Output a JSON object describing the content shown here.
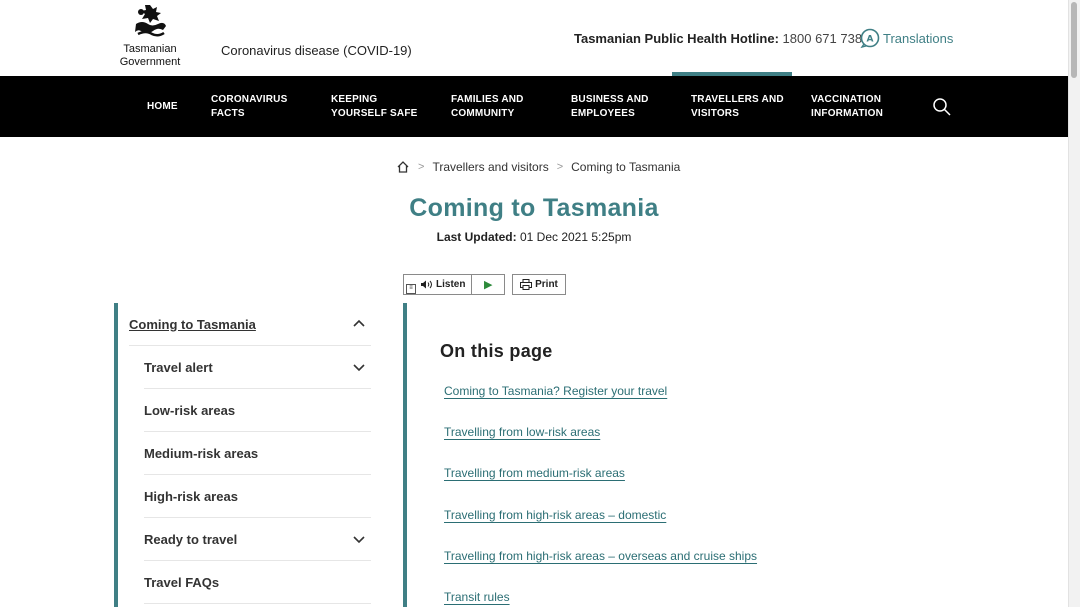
{
  "header": {
    "logo_line1": "Tasmanian",
    "logo_line2": "Government",
    "subtitle": "Coronavirus disease (COVID-19)",
    "hotline_label": "Tasmanian Public Health Hotline:",
    "hotline_number": "1800 671 738",
    "translations_label": "Translations"
  },
  "nav": {
    "items": [
      {
        "line1": "HOME",
        "line2": ""
      },
      {
        "line1": "CORONAVIRUS",
        "line2": "FACTS"
      },
      {
        "line1": "KEEPING",
        "line2": "YOURSELF SAFE"
      },
      {
        "line1": "FAMILIES AND",
        "line2": "COMMUNITY"
      },
      {
        "line1": "BUSINESS AND",
        "line2": "EMPLOYEES"
      },
      {
        "line1": "TRAVELLERS AND",
        "line2": "VISITORS"
      },
      {
        "line1": "VACCINATION",
        "line2": "INFORMATION"
      }
    ],
    "active_index": 5,
    "search_icon": "search-icon"
  },
  "breadcrumb": {
    "home_icon": "home-icon",
    "items": [
      "Travellers and visitors",
      "Coming to Tasmania"
    ]
  },
  "page": {
    "title": "Coming to Tasmania",
    "last_updated_label": "Last Updated:",
    "last_updated_value": "01 Dec 2021 5:25pm"
  },
  "tools": {
    "listen_label": "Listen",
    "print_label": "Print"
  },
  "sidebar": {
    "items": [
      {
        "label": "Coming to Tasmania",
        "chevron": "chevron-up-icon"
      },
      {
        "label": "Travel alert",
        "chevron": "chevron-down-icon"
      },
      {
        "label": "Low-risk areas",
        "chevron": ""
      },
      {
        "label": "Medium-risk areas",
        "chevron": ""
      },
      {
        "label": "High-risk areas",
        "chevron": ""
      },
      {
        "label": "Ready to travel",
        "chevron": "chevron-down-icon"
      },
      {
        "label": "Travel FAQs",
        "chevron": ""
      }
    ]
  },
  "content": {
    "on_this_page_heading": "On this page",
    "links": [
      "Coming to Tasmania? Register your travel",
      "Travelling from low-risk areas",
      "Travelling from medium-risk areas",
      "Travelling from high-risk areas – domestic",
      "Travelling from high-risk areas – overseas and cruise ships",
      "Transit rules"
    ]
  },
  "colors": {
    "accent": "#3f7f85",
    "nav_bg": "#000000",
    "link": "#2b6e74"
  }
}
